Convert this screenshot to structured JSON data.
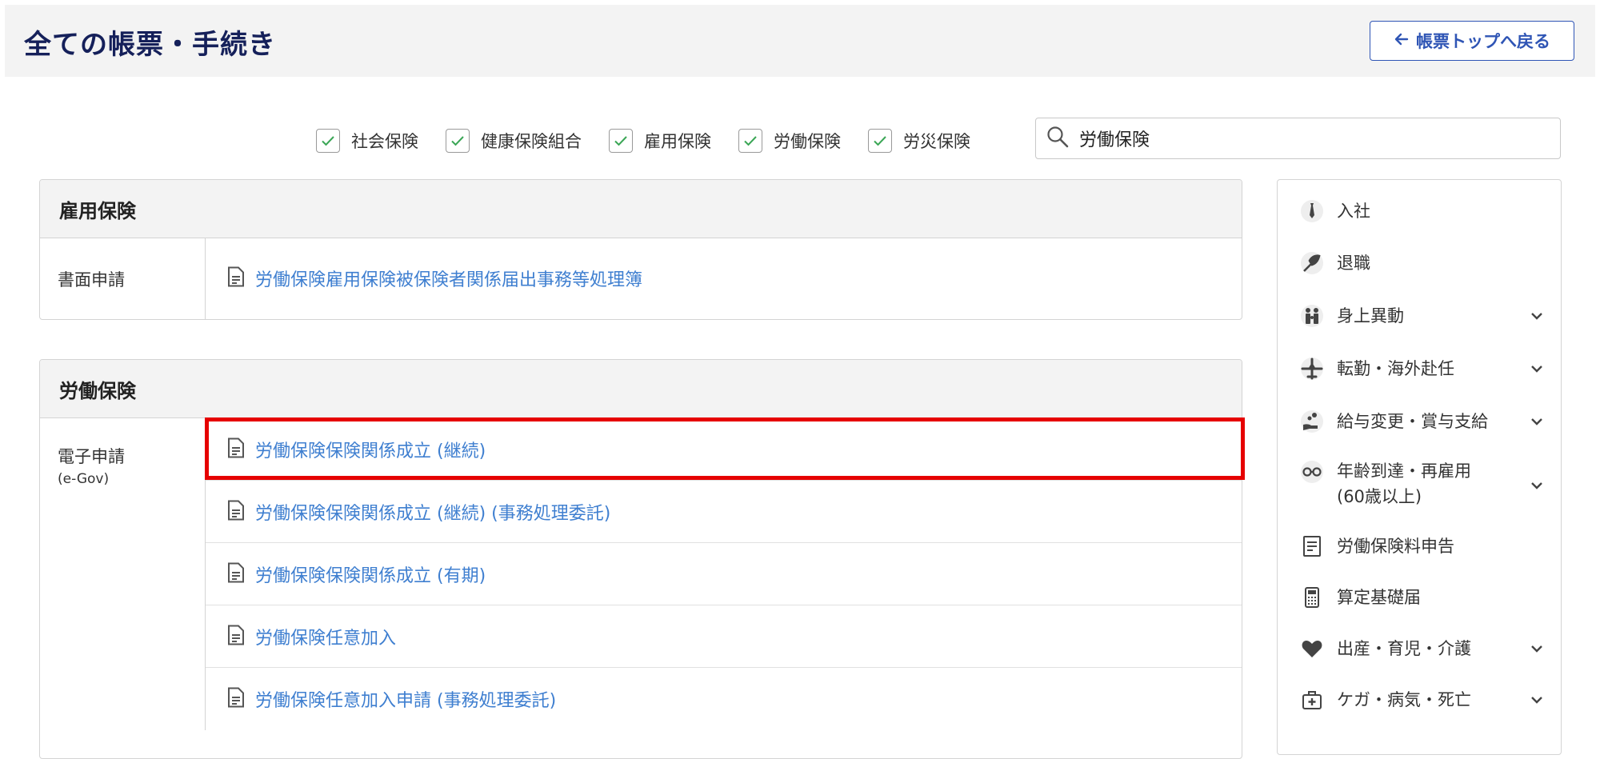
{
  "header": {
    "title": "全ての帳票・手続き",
    "back_label": "帳票トップへ戻る"
  },
  "filters": [
    {
      "label": "社会保険",
      "checked": true
    },
    {
      "label": "健康保険組合",
      "checked": true
    },
    {
      "label": "雇用保険",
      "checked": true
    },
    {
      "label": "労働保険",
      "checked": true
    },
    {
      "label": "労災保険",
      "checked": true
    }
  ],
  "search": {
    "value": "労働保険"
  },
  "sections": [
    {
      "title": "雇用保険",
      "groups": [
        {
          "type": "書面申請",
          "subtype": "",
          "forms": [
            "労働保険雇用保険被保険者関係届出事務等処理簿"
          ]
        }
      ]
    },
    {
      "title": "労働保険",
      "groups": [
        {
          "type": "電子申請",
          "subtype": "(e-Gov)",
          "forms": [
            "労働保険保険関係成立 (継続)",
            "労働保険保険関係成立 (継続) (事務処理委託)",
            "労働保険保険関係成立 (有期)",
            "労働保険任意加入",
            "労働保険任意加入申請 (事務処理委託)"
          ]
        }
      ]
    }
  ],
  "sidebar": {
    "items": [
      {
        "label": "入社",
        "icon": "necktie-icon",
        "expandable": false
      },
      {
        "label": "退職",
        "icon": "bouquet-icon",
        "expandable": false
      },
      {
        "label": "身上異動",
        "icon": "family-icon",
        "expandable": true
      },
      {
        "label": "転勤・海外赴任",
        "icon": "airplane-icon",
        "expandable": true
      },
      {
        "label": "給与変更・賞与支給",
        "icon": "hand-coins-icon",
        "expandable": true
      },
      {
        "label": "年齢到達・再雇用",
        "label2": "(60歳以上)",
        "icon": "glasses-icon",
        "expandable": true
      },
      {
        "label": "労働保険料申告",
        "icon": "document-icon",
        "expandable": false
      },
      {
        "label": "算定基礎届",
        "icon": "calculator-icon",
        "expandable": false
      },
      {
        "label": "出産・育児・介護",
        "icon": "heart-icon",
        "expandable": true
      },
      {
        "label": "ケガ・病気・死亡",
        "icon": "first-aid-icon",
        "expandable": true
      }
    ]
  },
  "colors": {
    "title": "#15205a",
    "link": "#3f7fd0",
    "accent_button": "#2f55b5",
    "checkmark": "#3aa655",
    "highlight": "#e60000"
  }
}
